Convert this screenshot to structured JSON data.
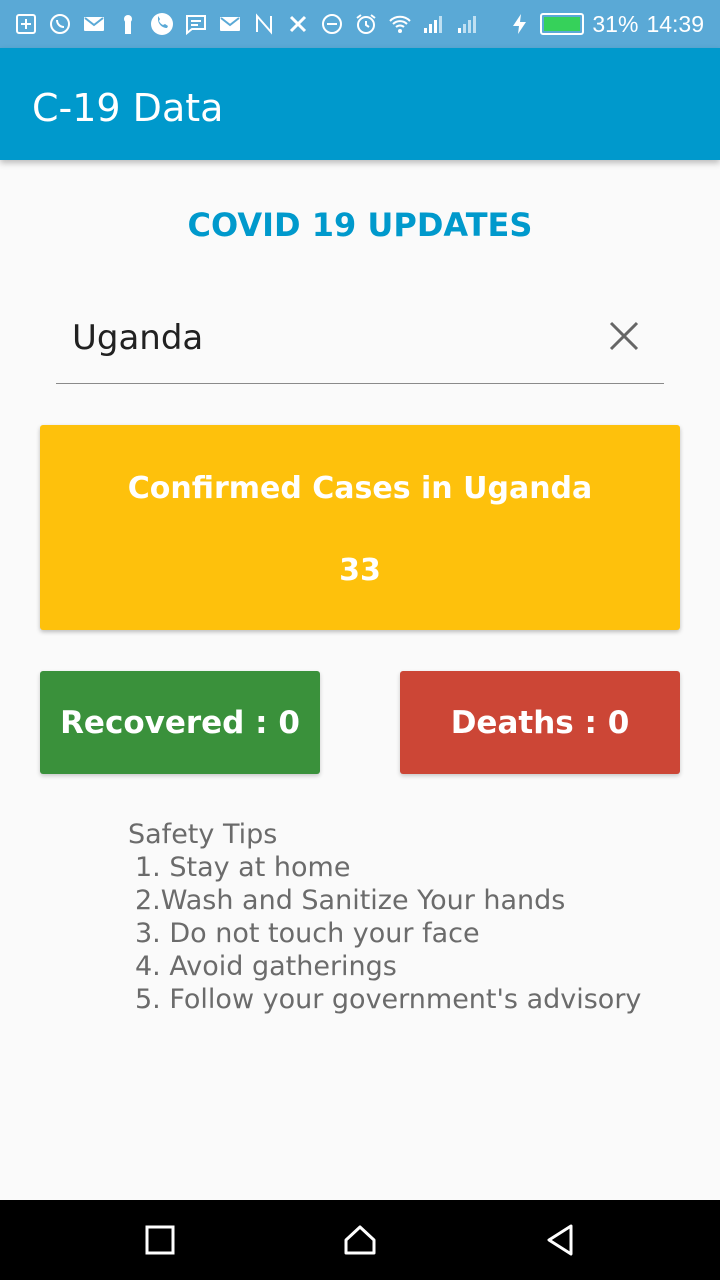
{
  "status_bar": {
    "icons": [
      "add-box-icon",
      "whatsapp-icon",
      "gmail-icon",
      "keyhole-icon",
      "phone-icon",
      "message-icon",
      "gmail-icon",
      "n-icon",
      "x-icon",
      "do-not-disturb-icon",
      "alarm-icon",
      "wifi-icon",
      "signal-icon",
      "signal-icon",
      "charging-icon",
      "battery-icon"
    ],
    "battery_percent": "31%",
    "time": "14:39",
    "battery_level": 0.31
  },
  "app_bar": {
    "title": "C-19 Data"
  },
  "heading": "COVID 19 UPDATES",
  "search": {
    "value": "Uganda",
    "placeholder": ""
  },
  "confirmed": {
    "title": "Confirmed Cases in Uganda",
    "count": "33"
  },
  "recovered": {
    "label": "Recovered : 0"
  },
  "deaths": {
    "label": "Deaths : 0"
  },
  "tips": {
    "title": "Safety Tips",
    "items": [
      "1. Stay at home",
      "2.Wash and Sanitize Your hands",
      "3. Do not touch your face",
      "4. Avoid gatherings",
      "5. Follow your government's advisory"
    ]
  },
  "nav": {
    "buttons": [
      "recents-icon",
      "home-icon",
      "back-icon"
    ]
  },
  "colors": {
    "status_bar": "#5aa9d6",
    "primary": "#0099cc",
    "confirmed": "#fec10c",
    "recovered": "#3a913b",
    "deaths": "#cc4636"
  }
}
